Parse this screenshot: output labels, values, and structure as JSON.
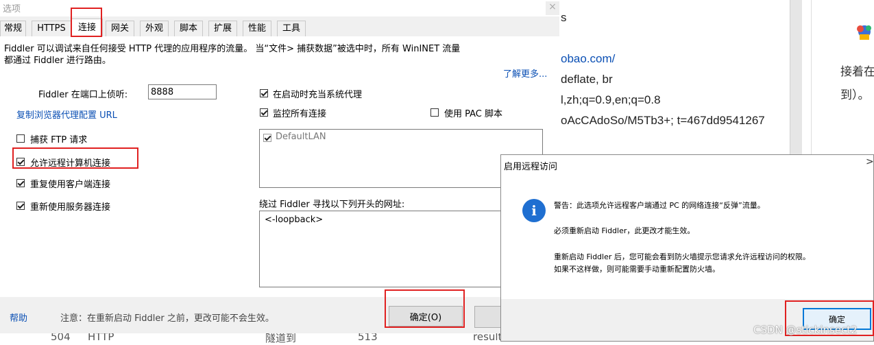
{
  "background": {
    "page_lines": [
      "s",
      "obao.com/",
      "deflate, br",
      "l,zh;q=0.9,en;q=0.8",
      "oAcCAdoSo/M5Tb3+; t=467dd9541267"
    ],
    "right_lines": [
      "接着在",
      "到）。"
    ],
    "bottom_row": [
      "504",
      "HTTP",
      "隧道到",
      "513",
      "resulturl"
    ]
  },
  "options": {
    "title": "选项",
    "close_label": "×",
    "tabs": [
      "常规",
      "HTTPS",
      "连接",
      "网关",
      "外观",
      "脚本",
      "扩展",
      "性能",
      "工具"
    ],
    "active_tab": "连接",
    "description_line1": "Fiddler 可以调试来自任何接受 HTTP 代理的应用程序的流量。 当“文件> 捕获数据”被选中时，所有 WinINET 流量",
    "description_line2": "都通过 Fiddler 进行路由。",
    "learn_more": "了解更多...",
    "port_label": "Fiddler 在端口上侦听:",
    "port_value": "8888",
    "copy_proxy_link": "复制浏览器代理配置 URL",
    "checkboxes": {
      "capture_ftp": {
        "label": "捕获 FTP 请求",
        "checked": false
      },
      "allow_remote": {
        "label": "允许远程计算机连接",
        "checked": true
      },
      "reuse_client": {
        "label": "重复使用客户端连接",
        "checked": true
      },
      "reuse_server": {
        "label": "重新使用服务器连接",
        "checked": true
      },
      "act_as_system_proxy": {
        "label": "在启动时充当系统代理",
        "checked": true
      },
      "monitor_all": {
        "label": "监控所有连接",
        "checked": true
      },
      "use_pac": {
        "label": "使用 PAC 脚本",
        "checked": false
      }
    },
    "connection_list": [
      {
        "label": "DefaultLAN",
        "checked": true
      }
    ],
    "bypass_label": "绕过 Fiddler 寻找以下列开头的网址:",
    "bypass_value": "<-loopback>",
    "help_link": "帮助",
    "footer_note": "注意：在重新启动 Fiddler 之前，更改可能不会生效。",
    "ok_label": "确定(O)"
  },
  "remote_dialog": {
    "title": "启用远程访问",
    "close_label": ">",
    "icon": "info-icon",
    "warning": "警告：此选项允许远程客户端通过 PC 的网络连接“反弹”流量。",
    "restart_required": "必须重新启动 Fiddler，此更改才能生效。",
    "firewall_line1": "重新启动 Fiddler 后，您可能会看到防火墙提示您请求允许远程访问的权限。",
    "firewall_line2": "如果不这样做，则可能需要手动重新配置防火墙。",
    "ok_label": "确定"
  },
  "watermark": "CSDN @stickinsect2",
  "colors": {
    "highlight": "#e02020",
    "link": "#0a4fb4",
    "info_icon": "#1f6fd1",
    "focus_border": "#0078d7"
  }
}
